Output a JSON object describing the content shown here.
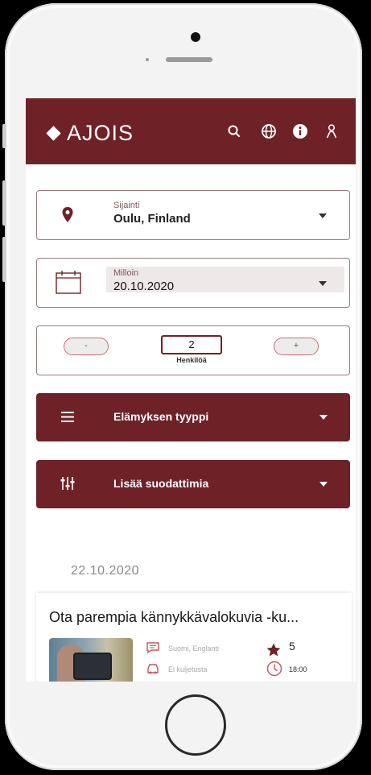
{
  "app": {
    "logo_text": "AJOIS"
  },
  "header_icons": [
    "search-icon",
    "globe-icon",
    "info-icon",
    "user-icon"
  ],
  "location": {
    "label": "Sijainti",
    "value": "Oulu, Finland",
    "icon": "map-pin-icon"
  },
  "date": {
    "label": "Milloin",
    "value": "20.10.2020",
    "icon": "calendar-icon"
  },
  "people": {
    "minus_label": "-",
    "count": "2",
    "plus_label": "+",
    "caption": "Henkilöä"
  },
  "experience_type": {
    "label": "Elämyksen tyyppi",
    "icon": "menu-icon"
  },
  "more_filters": {
    "label": "Lisää suodattimia",
    "icon": "sliders-icon"
  },
  "results": {
    "date_heading": "22.10.2020",
    "items": [
      {
        "title": "Ota parempia kännykkävalokuvia -ku...",
        "languages": "Suomi, Englanti",
        "transport": "Ei kuljetusta",
        "rating": "5",
        "time": "18:00"
      }
    ]
  },
  "colors": {
    "brand": "#6e2228",
    "accent_border": "#d06a70",
    "date_field_bg": "#efe8e8"
  }
}
